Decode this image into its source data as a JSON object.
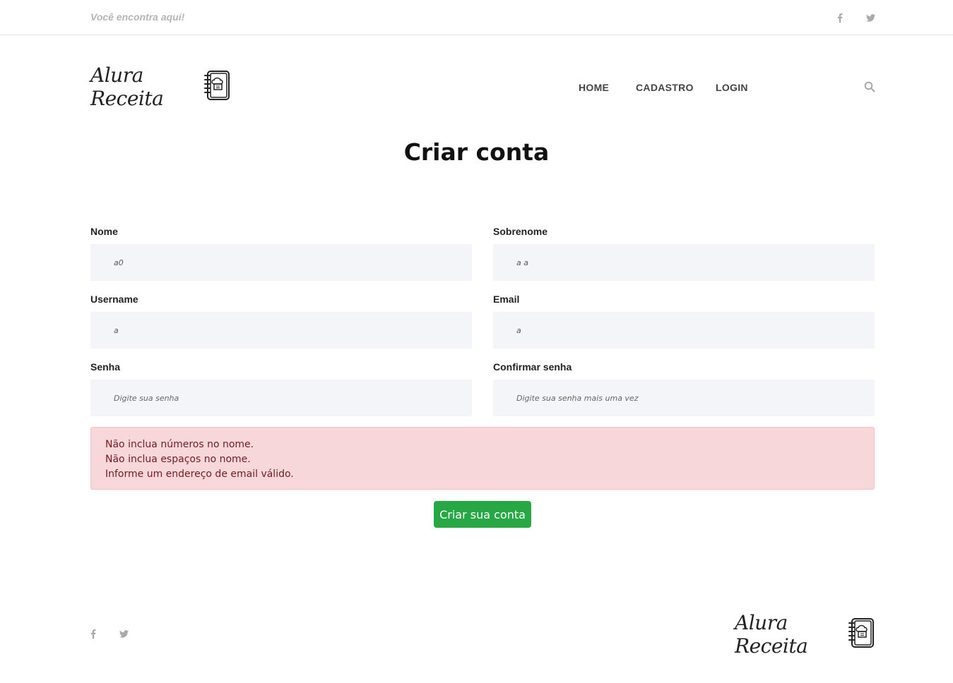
{
  "topbar": {
    "tagline": "Você encontra aqui!",
    "social": [
      {
        "icon": "facebook-icon"
      },
      {
        "icon": "twitter-icon"
      }
    ]
  },
  "header": {
    "logo_text": "Alura Receita",
    "logo_icon": "recipe-book-icon",
    "nav": [
      {
        "label": "HOME"
      },
      {
        "label": "CADASTRO"
      },
      {
        "label": "LOGIN"
      }
    ],
    "search_icon": "search-icon"
  },
  "main": {
    "title": "Criar conta",
    "fields": {
      "nome": {
        "label": "Nome",
        "value": "a0",
        "placeholder": ""
      },
      "sobrenome": {
        "label": "Sobrenome",
        "value": "a a",
        "placeholder": ""
      },
      "username": {
        "label": "Username",
        "value": "a",
        "placeholder": ""
      },
      "email": {
        "label": "Email",
        "value": "a",
        "placeholder": ""
      },
      "senha": {
        "label": "Senha",
        "value": "",
        "placeholder": "Digite sua senha"
      },
      "confirmar_senha": {
        "label": "Confirmar senha",
        "value": "",
        "placeholder": "Digite sua senha mais uma vez"
      }
    },
    "errors": [
      "Não inclua números no nome.",
      "Não inclua espaços no nome.",
      "Informe um endereço de email válido."
    ],
    "submit_label": "Criar sua conta"
  },
  "footer": {
    "logo_text": "Alura Receita",
    "social": [
      {
        "icon": "facebook-icon"
      },
      {
        "icon": "twitter-icon"
      }
    ]
  },
  "colors": {
    "accent_green": "#28a745",
    "alert_bg": "#f8d7da",
    "alert_text": "#721c24",
    "input_bg": "#f4f5f9",
    "muted_icon": "#a9a9a9"
  }
}
